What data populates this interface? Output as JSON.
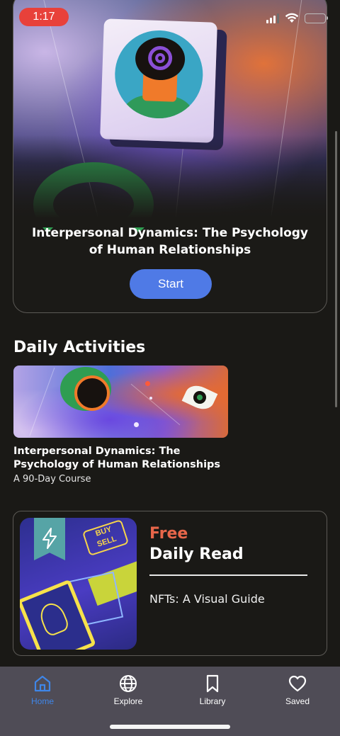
{
  "status_bar": {
    "time": "1:17",
    "time_badge_color": "#e8413a",
    "battery_color": "#f5cc22"
  },
  "featured": {
    "title": "Interpersonal Dynamics: The Psychology of Human Relationships",
    "start_label": "Start",
    "accent_color": "#4f7ae6"
  },
  "daily_activities": {
    "section_title": "Daily Activities",
    "items": [
      {
        "title": "Interpersonal Dynamics: The Psychology of Human Relationships",
        "subtitle": "A 90-Day Course"
      }
    ]
  },
  "daily_read": {
    "badge": "Free",
    "title": "Daily Read",
    "article": "NFTs: A Visual Guide",
    "thumbnail_text": [
      "BUY",
      "SELL"
    ],
    "badge_color": "#e8664a"
  },
  "bottom_nav": {
    "items": [
      {
        "label": "Home",
        "icon": "home-icon",
        "active": true
      },
      {
        "label": "Explore",
        "icon": "globe-icon",
        "active": false
      },
      {
        "label": "Library",
        "icon": "bookmark-icon",
        "active": false
      },
      {
        "label": "Saved",
        "icon": "heart-icon",
        "active": false
      }
    ],
    "active_color": "#3f86e8"
  }
}
